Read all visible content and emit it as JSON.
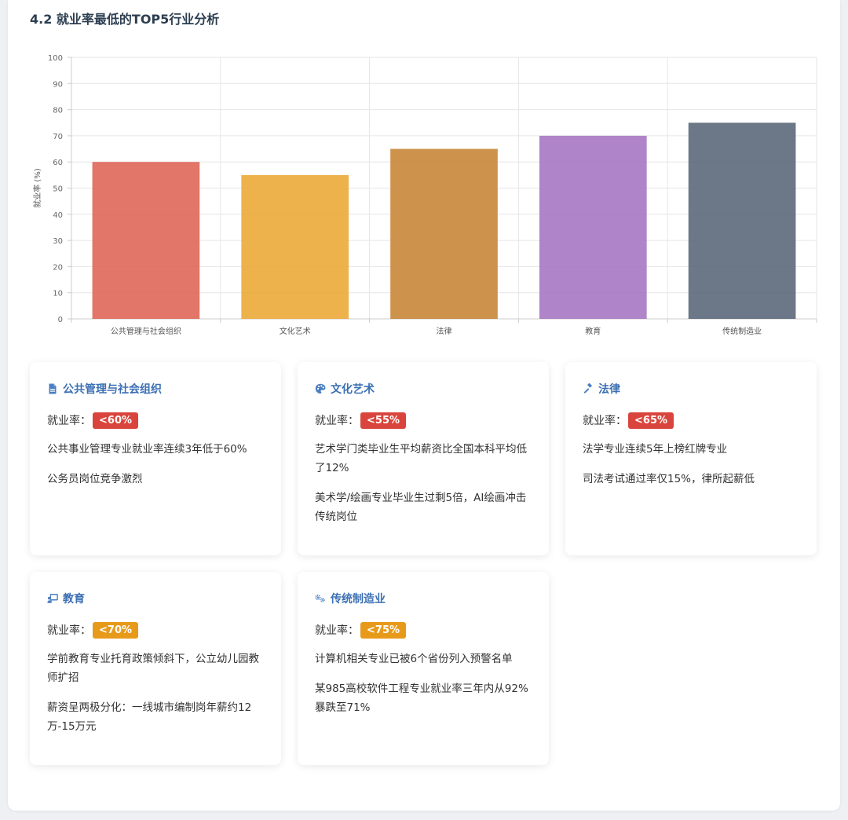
{
  "section_title": "4.2 就业率最低的TOP5行业分析",
  "chart_data": {
    "type": "bar",
    "categories": [
      "公共管理与社会组织",
      "文化艺术",
      "法律",
      "教育",
      "传统制造业"
    ],
    "values": [
      60,
      55,
      65,
      70,
      75
    ],
    "colors": [
      "#e06a5c",
      "#ebab3c",
      "#c98a3e",
      "#a879c4",
      "#5f6b7d"
    ],
    "ylabel": "就业率 (%)",
    "ylim": [
      0,
      100
    ],
    "yticks": [
      0,
      10,
      20,
      30,
      40,
      50,
      60,
      70,
      80,
      90,
      100
    ],
    "grid": true
  },
  "cards": [
    {
      "title": "公共管理与社会组织",
      "icon": "document-icon",
      "rate_label": "就业率：",
      "rate": "<60%",
      "badge_color": "#d9453c",
      "items": [
        "公共事业管理专业就业率连续3年低于60%",
        "公务员岗位竞争激烈"
      ]
    },
    {
      "title": "文化艺术",
      "icon": "palette-icon",
      "rate_label": "就业率：",
      "rate": "<55%",
      "badge_color": "#d9453c",
      "items": [
        "艺术学门类毕业生平均薪资比全国本科平均低了12%",
        "美术学/绘画专业毕业生过剩5倍，AI绘画冲击传统岗位"
      ]
    },
    {
      "title": "法律",
      "icon": "gavel-icon",
      "rate_label": "就业率：",
      "rate": "<65%",
      "badge_color": "#d9453c",
      "items": [
        "法学专业连续5年上榜红牌专业",
        "司法考试通过率仅15%，律所起薪低"
      ]
    },
    {
      "title": "教育",
      "icon": "teacher-icon",
      "rate_label": "就业率：",
      "rate": "<70%",
      "badge_color": "#e79a1a",
      "items": [
        "学前教育专业托育政策倾斜下，公立幼儿园教师扩招",
        "薪资呈两极分化：一线城市编制岗年薪约12万-15万元"
      ]
    },
    {
      "title": "传统制造业",
      "icon": "gears-icon",
      "rate_label": "就业率：",
      "rate": "<75%",
      "badge_color": "#e79a1a",
      "items": [
        "计算机相关专业已被6个省份列入预警名单",
        "某985高校软件工程专业就业率三年内从92%暴跌至71%"
      ]
    }
  ]
}
